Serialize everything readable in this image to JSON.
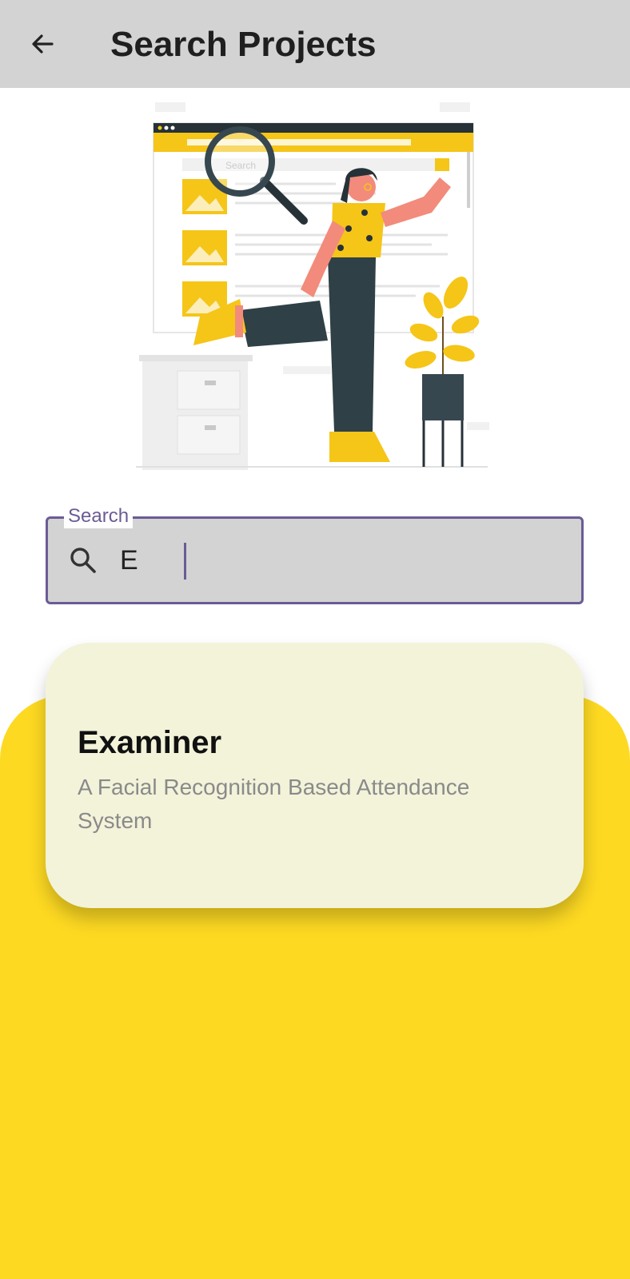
{
  "header": {
    "title": "Search Projects",
    "back_icon": "arrow-left-icon"
  },
  "illustration": {
    "embedded_search_text": "Search"
  },
  "search": {
    "label": "Search",
    "value": "E",
    "icon": "search-icon"
  },
  "results": [
    {
      "title": "Examiner",
      "description": "A Facial Recognition Based Attendance System"
    }
  ],
  "colors": {
    "app_bar": "#d3d3d3",
    "accent": "#6b5b95",
    "panel_yellow": "#fdd922",
    "card": "#f3f3da"
  }
}
